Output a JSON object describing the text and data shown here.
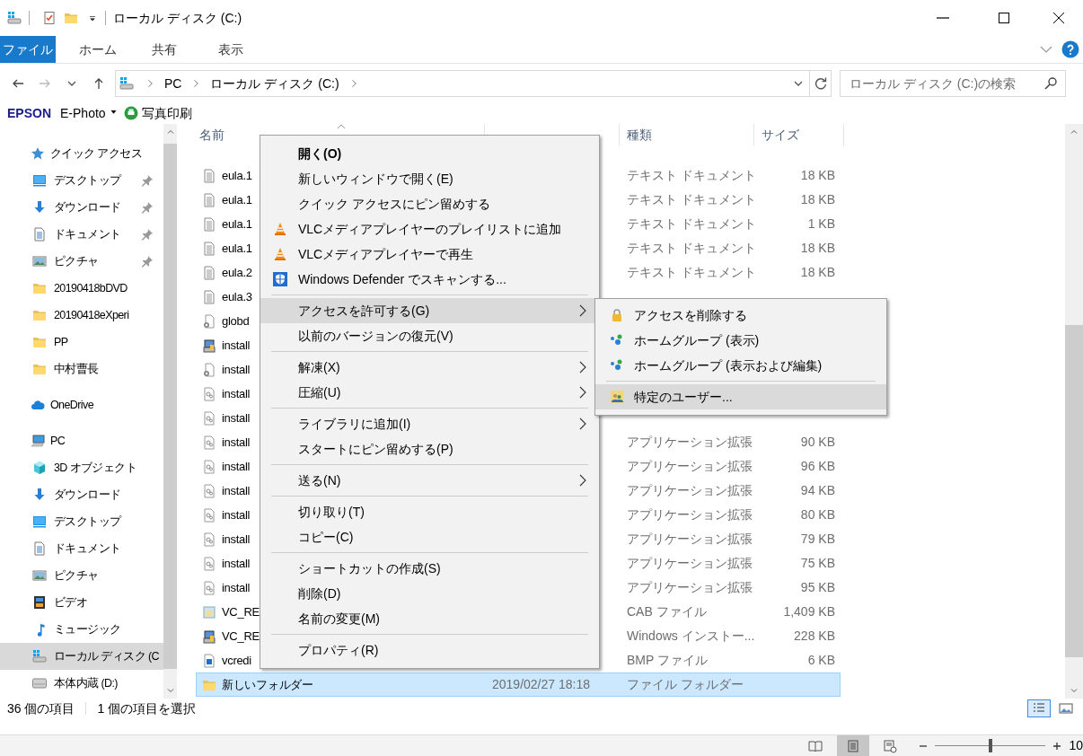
{
  "title_bar": {
    "title": "ローカル ディスク (C:)"
  },
  "ribbon_tabs": [
    {
      "label": "ファイル",
      "selected": true
    },
    {
      "label": "ホーム",
      "selected": false
    },
    {
      "label": "共有",
      "selected": false
    },
    {
      "label": "表示",
      "selected": false
    }
  ],
  "address_bar": {
    "path": [
      "PC",
      "ローカル ディスク (C:)"
    ]
  },
  "search": {
    "placeholder": "ローカル ディスク (C:)の検索"
  },
  "epson_toolbar": {
    "brand": "EPSON",
    "product": "E-Photo",
    "action": "写真印刷"
  },
  "nav_pane": [
    {
      "label": "クイック アクセス",
      "kind": "star",
      "selected": false,
      "children": [
        {
          "label": "デスクトップ",
          "kind": "desktop",
          "pinned": true,
          "selected": false
        },
        {
          "label": "ダウンロード",
          "kind": "download",
          "pinned": true,
          "selected": false
        },
        {
          "label": "ドキュメント",
          "kind": "document",
          "pinned": true,
          "selected": false
        },
        {
          "label": "ピクチャ",
          "kind": "picture",
          "pinned": true,
          "selected": false
        },
        {
          "label": "20190418bDVD",
          "kind": "folder",
          "pinned": false,
          "selected": false
        },
        {
          "label": "20190418eXperi",
          "kind": "folder",
          "pinned": false,
          "selected": false
        },
        {
          "label": "PP",
          "kind": "folder",
          "pinned": false,
          "selected": false
        },
        {
          "label": "中村曹長",
          "kind": "folder",
          "pinned": false,
          "selected": false
        }
      ]
    },
    {
      "label": "OneDrive",
      "kind": "cloud",
      "selected": false
    },
    {
      "label": "PC",
      "kind": "pc",
      "selected": false,
      "children": [
        {
          "label": "3D オブジェクト",
          "kind": "cube",
          "pinned": false,
          "selected": false
        },
        {
          "label": "ダウンロード",
          "kind": "download",
          "pinned": false,
          "selected": false
        },
        {
          "label": "デスクトップ",
          "kind": "desktop",
          "pinned": false,
          "selected": false
        },
        {
          "label": "ドキュメント",
          "kind": "document",
          "pinned": false,
          "selected": false
        },
        {
          "label": "ピクチャ",
          "kind": "picture",
          "pinned": false,
          "selected": false
        },
        {
          "label": "ビデオ",
          "kind": "video",
          "pinned": false,
          "selected": false
        },
        {
          "label": "ミュージック",
          "kind": "music",
          "pinned": false,
          "selected": false
        },
        {
          "label": "ローカル ディスク (C",
          "kind": "drive",
          "pinned": false,
          "selected": true
        },
        {
          "label": "本体内蔵 (D:)",
          "kind": "disk",
          "pinned": false,
          "selected": false
        }
      ]
    }
  ],
  "columns": {
    "name": "名前",
    "type": "種類",
    "size": "サイズ"
  },
  "files": [
    {
      "name": "eula.1",
      "kind": "text",
      "type": "テキスト ドキュメント",
      "size": "18 KB",
      "selected": false
    },
    {
      "name": "eula.1",
      "kind": "text",
      "type": "テキスト ドキュメント",
      "size": "18 KB",
      "selected": false
    },
    {
      "name": "eula.1",
      "kind": "text",
      "type": "テキスト ドキュメント",
      "size": "1 KB",
      "selected": false
    },
    {
      "name": "eula.1",
      "kind": "text",
      "type": "テキスト ドキュメント",
      "size": "18 KB",
      "selected": false
    },
    {
      "name": "eula.2",
      "kind": "text",
      "type": "テキスト ドキュメント",
      "size": "18 KB",
      "selected": false
    },
    {
      "name": "eula.3",
      "kind": "text",
      "selected": false
    },
    {
      "name": "globd",
      "kind": "gear",
      "selected": false
    },
    {
      "name": "install",
      "kind": "installer",
      "selected": false
    },
    {
      "name": "install",
      "kind": "gear",
      "selected": false
    },
    {
      "name": "install",
      "kind": "ext",
      "selected": false
    },
    {
      "name": "install",
      "kind": "ext",
      "selected": false
    },
    {
      "name": "install",
      "kind": "ext",
      "type": "アプリケーション拡張",
      "size": "90 KB",
      "selected": false
    },
    {
      "name": "install",
      "kind": "ext",
      "type": "アプリケーション拡張",
      "size": "96 KB",
      "selected": false
    },
    {
      "name": "install",
      "kind": "ext",
      "type": "アプリケーション拡張",
      "size": "94 KB",
      "selected": false
    },
    {
      "name": "install",
      "kind": "ext",
      "type": "アプリケーション拡張",
      "size": "80 KB",
      "selected": false
    },
    {
      "name": "install",
      "kind": "ext",
      "type": "アプリケーション拡張",
      "size": "79 KB",
      "selected": false
    },
    {
      "name": "install",
      "kind": "ext",
      "type": "アプリケーション拡張",
      "size": "75 KB",
      "selected": false
    },
    {
      "name": "install",
      "kind": "ext",
      "type": "アプリケーション拡張",
      "size": "95 KB",
      "selected": false
    },
    {
      "name": "VC_RE",
      "kind": "cab",
      "type": "CAB ファイル",
      "size": "1,409 KB",
      "selected": false
    },
    {
      "name": "VC_RE",
      "kind": "installer",
      "type": "Windows インストー...",
      "size": "228 KB",
      "selected": false
    },
    {
      "name": "vcredi",
      "kind": "bmp",
      "type": "BMP ファイル",
      "size": "6 KB",
      "selected": false
    },
    {
      "name": "新しいフォルダー",
      "kind": "folder",
      "modified": "2019/02/27 18:18",
      "type": "ファイル フォルダー",
      "selected": true
    }
  ],
  "context_menu": [
    {
      "kind": "item",
      "label": "開く(O)",
      "bold": true,
      "highlighted": false,
      "submenu": false
    },
    {
      "kind": "item",
      "label": "新しいウィンドウで開く(E)",
      "bold": false,
      "highlighted": false,
      "submenu": false
    },
    {
      "kind": "item",
      "label": "クイック アクセスにピン留めする",
      "bold": false,
      "highlighted": false,
      "submenu": false
    },
    {
      "kind": "vlc",
      "label": "VLCメディアプレイヤーのプレイリストに追加",
      "bold": false,
      "highlighted": false,
      "submenu": false
    },
    {
      "kind": "vlc",
      "label": "VLCメディアプレイヤーで再生",
      "bold": false,
      "highlighted": false,
      "submenu": false
    },
    {
      "kind": "scan",
      "label": "Windows Defender でスキャンする...",
      "bold": false,
      "highlighted": false,
      "submenu": false
    },
    {
      "kind": "separator"
    },
    {
      "kind": "item",
      "label": "アクセスを許可する(G)",
      "bold": false,
      "highlighted": true,
      "submenu": true
    },
    {
      "kind": "item",
      "label": "以前のバージョンの復元(V)",
      "bold": false,
      "highlighted": false,
      "submenu": false
    },
    {
      "kind": "separator"
    },
    {
      "kind": "item",
      "label": "解凍(X)",
      "bold": false,
      "highlighted": false,
      "submenu": true
    },
    {
      "kind": "item",
      "label": "圧縮(U)",
      "bold": false,
      "highlighted": false,
      "submenu": true
    },
    {
      "kind": "separator"
    },
    {
      "kind": "item",
      "label": "ライブラリに追加(I)",
      "bold": false,
      "highlighted": false,
      "submenu": true
    },
    {
      "kind": "item",
      "label": "スタートにピン留めする(P)",
      "bold": false,
      "highlighted": false,
      "submenu": false
    },
    {
      "kind": "separator"
    },
    {
      "kind": "item",
      "label": "送る(N)",
      "bold": false,
      "highlighted": false,
      "submenu": true
    },
    {
      "kind": "separator"
    },
    {
      "kind": "item",
      "label": "切り取り(T)",
      "bold": false,
      "highlighted": false,
      "submenu": false
    },
    {
      "kind": "item",
      "label": "コピー(C)",
      "bold": false,
      "highlighted": false,
      "submenu": false
    },
    {
      "kind": "separator"
    },
    {
      "kind": "item",
      "label": "ショートカットの作成(S)",
      "bold": false,
      "highlighted": false,
      "submenu": false
    },
    {
      "kind": "item",
      "label": "削除(D)",
      "bold": false,
      "highlighted": false,
      "submenu": false
    },
    {
      "kind": "item",
      "label": "名前の変更(M)",
      "bold": false,
      "highlighted": false,
      "submenu": false
    },
    {
      "kind": "separator"
    },
    {
      "kind": "item",
      "label": "プロパティ(R)",
      "bold": false,
      "highlighted": false,
      "submenu": false
    }
  ],
  "submenu": [
    {
      "kind": "remove",
      "label": "アクセスを削除する",
      "highlighted": false
    },
    {
      "kind": "homegroup",
      "label": "ホームグループ (表示)",
      "highlighted": false
    },
    {
      "kind": "homegroup",
      "label": "ホームグループ (表示および編集)",
      "highlighted": false
    },
    {
      "kind": "separator"
    },
    {
      "kind": "user",
      "label": "特定のユーザー...",
      "highlighted": true
    }
  ],
  "status_bar": {
    "item_count": "36 個の項目",
    "selection": "1 個の項目を選択",
    "views": [
      {
        "kind": "details",
        "selected": true
      },
      {
        "kind": "tiles",
        "selected": false
      }
    ]
  },
  "word_status_bar": {
    "views": [
      {
        "kind": "read",
        "selected": false
      },
      {
        "kind": "print",
        "selected": true
      },
      {
        "kind": "web",
        "selected": false
      }
    ],
    "zoom": {
      "level": 0.5,
      "label": "10"
    }
  }
}
